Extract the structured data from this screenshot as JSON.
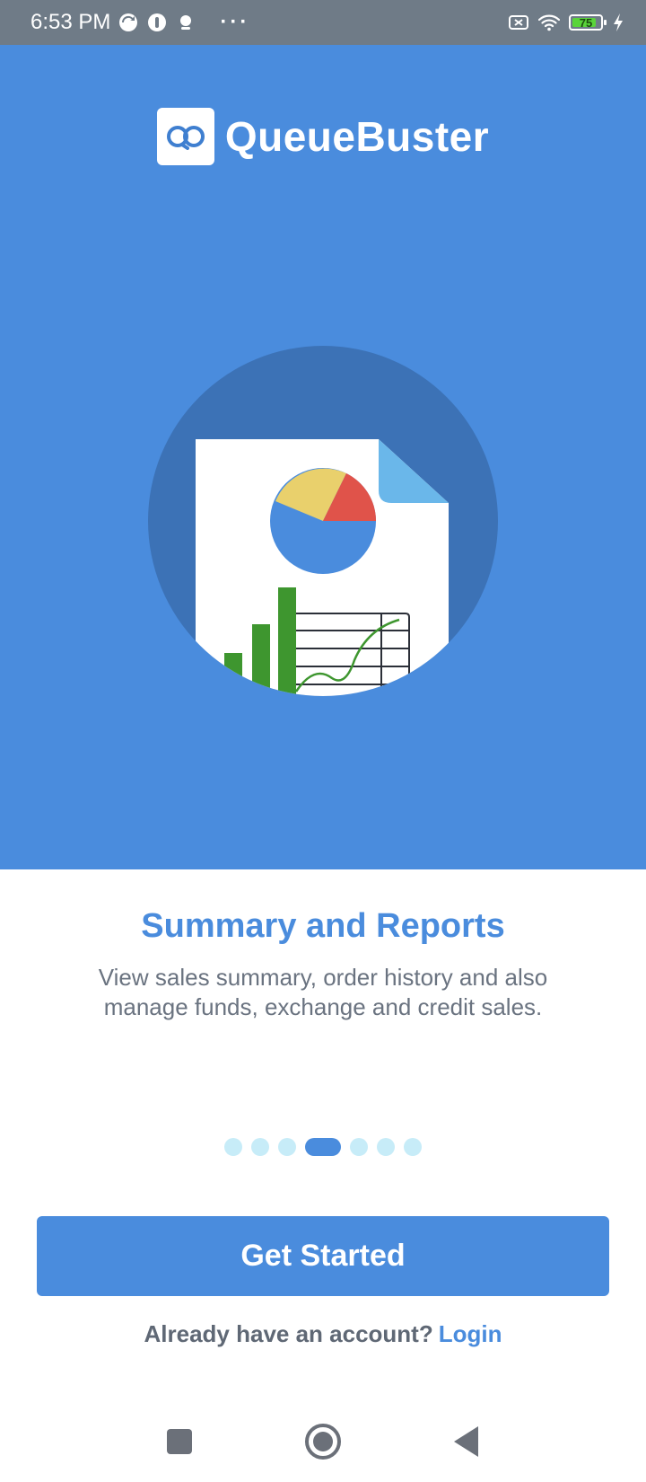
{
  "status_bar": {
    "time": "6:53 PM",
    "more": "···",
    "battery_level": "75",
    "icons": [
      "sync-icon",
      "app-icon",
      "notification-icon",
      "no-sim-icon",
      "wifi-icon",
      "battery-icon",
      "charging-icon"
    ]
  },
  "brand": {
    "name": "QueueBuster",
    "color": "#4a8cdd"
  },
  "slide": {
    "title": "Summary and Reports",
    "description": "View sales summary, order history and also manage funds, exchange and credit sales.",
    "illustration": "report-document-icon"
  },
  "pager": {
    "count": 7,
    "active_index": 3
  },
  "actions": {
    "get_started": "Get Started",
    "login_prompt": "Already have an account?",
    "login_link": "Login"
  },
  "nav": {
    "icons": [
      "recents-icon",
      "home-icon",
      "back-icon"
    ]
  }
}
